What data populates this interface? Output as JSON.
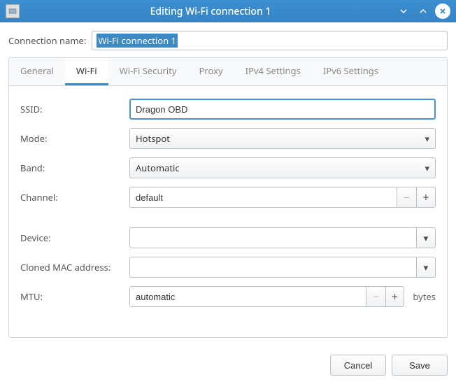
{
  "titlebar": {
    "title": "Editing Wi-Fi connection 1"
  },
  "connection": {
    "name_label": "Connection name:",
    "name_value": "Wi-Fi connection 1"
  },
  "tabs": {
    "general": "General",
    "wifi": "Wi-Fi",
    "wifi_security": "Wi-Fi Security",
    "proxy": "Proxy",
    "ipv4": "IPv4 Settings",
    "ipv6": "IPv6 Settings"
  },
  "wifi": {
    "ssid_label": "SSID:",
    "ssid_value": "Dragon OBD",
    "mode_label": "Mode:",
    "mode_value": "Hotspot",
    "band_label": "Band:",
    "band_value": "Automatic",
    "channel_label": "Channel:",
    "channel_value": "default",
    "device_label": "Device:",
    "device_value": "",
    "cloned_mac_label": "Cloned MAC address:",
    "cloned_mac_value": "",
    "mtu_label": "MTU:",
    "mtu_value": "automatic",
    "mtu_unit": "bytes"
  },
  "buttons": {
    "minus": "−",
    "plus": "+",
    "cancel": "Cancel",
    "save": "Save"
  },
  "icons": {
    "chevron_down": "▾"
  }
}
